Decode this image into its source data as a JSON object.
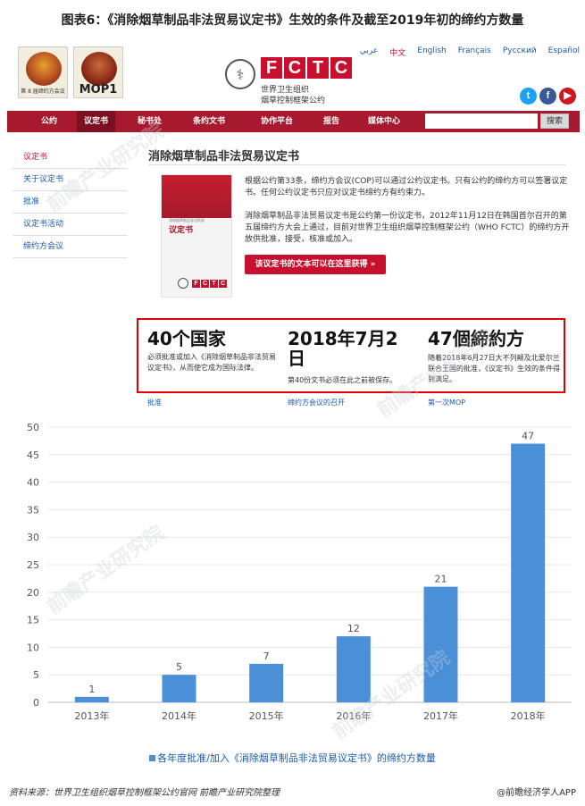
{
  "figure_title": "图表6：《消除烟草制品非法贸易议定书》生效的条件及截至2019年初的缔约方数量",
  "header": {
    "logo_mop8_caption": "第 8 届缔约方会议",
    "logo_mop1_caption": "MOP1",
    "fctc_letters": [
      "F",
      "C",
      "T",
      "C"
    ],
    "fctc_line1": "世界卫生组织",
    "fctc_line2": "烟草控制框架公约",
    "languages": [
      "عربي",
      "中文",
      "English",
      "Français",
      "Русский",
      "Español"
    ],
    "active_language": "中文",
    "social": [
      "twitter-icon",
      "facebook-icon",
      "youtube-icon"
    ]
  },
  "nav": {
    "items": [
      "公约",
      "议定书",
      "秘书处",
      "条约文书",
      "协作平台",
      "报告",
      "媒体中心"
    ],
    "active": "议定书",
    "search_placeholder": "",
    "search_label": "搜索"
  },
  "sidebar": {
    "items": [
      "议定书",
      "关于议定书",
      "批准",
      "议定书活动",
      "缔约方会议"
    ],
    "active": "议定书"
  },
  "main": {
    "title": "消除烟草制品非法贸易议定书",
    "cover_subtitle": "消除烟草制品非法贸易",
    "cover_title": "议定书",
    "para1": "根据公约第33条，缔约方会议(COP)可以通过公约议定书。只有公约的缔约方可以签署议定书。任何公约议定书只应对议定书缔约方有约束力。",
    "para2": "消除烟草制品非法贸易议定书是公约第一份议定书，2012年11月12日在韩国首尔召开的第五届缔约方大会上通过，目前对世界卫生组织烟草控制框架公约（WHO FCTC）的缔约方开放供批准，接受，核准或加入。",
    "cta_label": "该议定书的文本可以在这里获得 »"
  },
  "stats": [
    {
      "big": "40个国家",
      "desc": "必须批准或加入《消除烟草制品非法贸易议定书》，从而使它成为国际法律。",
      "caption": "批准"
    },
    {
      "big": "2018年7月2日",
      "desc": "第40份文书必须在此之前被保存。",
      "caption": "缔约方会议的召开"
    },
    {
      "big": "47個締約方",
      "desc": "随着2018年6月27日大不列颠及北爱尔兰联合王国的批准，《议定书》生效的条件得到满足。",
      "caption": "第一次MOP"
    }
  ],
  "chart_data": {
    "type": "bar",
    "categories": [
      "2013年",
      "2014年",
      "2015年",
      "2016年",
      "2017年",
      "2018年"
    ],
    "values": [
      1,
      5,
      7,
      12,
      21,
      47
    ],
    "ylim": [
      0,
      50
    ],
    "yticks": [
      0,
      5,
      10,
      15,
      20,
      25,
      30,
      35,
      40,
      45,
      50
    ],
    "legend": "各年度批准/加入《消除烟草制品非法贸易议定书》的缔约方数量",
    "grid": true,
    "bar_color": "#4a90d9"
  },
  "footer": {
    "source": "资料来源：世界卫生组织烟草控制框架公约官网  前瞻产业研究院整理",
    "brand": "@前瞻经济学人APP"
  },
  "watermark": "前瞻产业研究院"
}
